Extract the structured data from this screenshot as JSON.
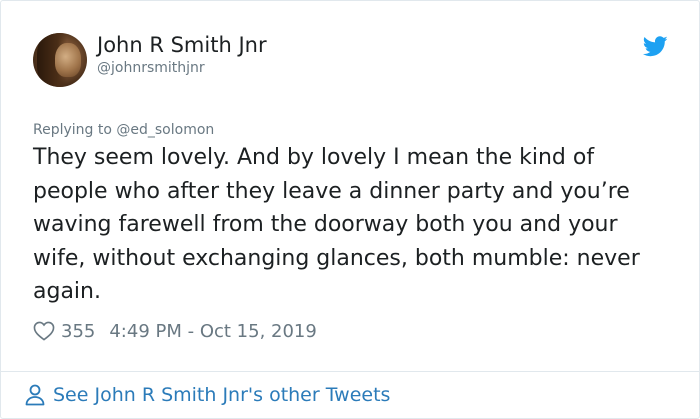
{
  "tweet": {
    "author": {
      "name": "John R Smith Jnr",
      "handle": "@johnrsmithjnr"
    },
    "replying_to_prefix": "Replying to ",
    "replying_to_handle": "@ed_solomon",
    "text": "They seem lovely. And by lovely I mean the kind of people who after they leave a dinner party and you’re waving farewell from the doorway both you and your wife, without exchanging glances, both mumble: never again.",
    "likes": "355",
    "timestamp": "4:49 PM - Oct 15, 2019"
  },
  "footer": {
    "link_label": "See John R Smith Jnr's other Tweets"
  },
  "colors": {
    "brand": "#1da1f2",
    "link": "#2b7bb9",
    "muted": "#697882",
    "text": "#1c2022",
    "border": "#e1e8ed"
  },
  "icons": {
    "brand": "twitter-bird-icon",
    "like": "heart-icon",
    "profile": "person-icon"
  }
}
